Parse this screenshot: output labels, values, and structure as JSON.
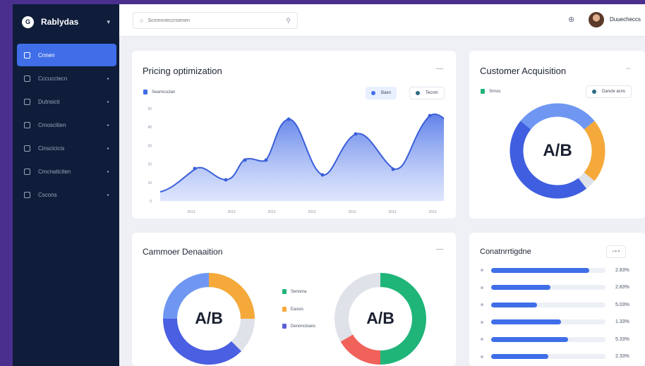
{
  "brand": {
    "name": "Rablydas",
    "logo_letter": "G"
  },
  "nav": [
    {
      "label": "Cnnen",
      "active": true
    },
    {
      "label": "Cccucctecn",
      "active": false
    },
    {
      "label": "Dutnsicti",
      "active": false
    },
    {
      "label": "Cmoscitien",
      "active": false
    },
    {
      "label": "Cinscicicis",
      "active": false
    },
    {
      "label": "Cmcnaticiten",
      "active": false
    },
    {
      "label": "Cscons",
      "active": false
    }
  ],
  "search": {
    "placeholder": "Scnmnneccnsenen"
  },
  "user": {
    "name": "Duuecheccs"
  },
  "pricing": {
    "title": "Pricing optimization",
    "legend": "Searncsctan",
    "chip1": "Baen",
    "chip2": "Tecnm",
    "more": "—",
    "y_ticks": [
      "0",
      "10",
      "20",
      "30",
      "40",
      "50"
    ],
    "x_ticks": [
      "2013",
      "2013",
      "2013",
      "2013",
      "2013",
      "2013",
      "2013"
    ]
  },
  "acquisition": {
    "title": "Customer Acquisition",
    "legend": "Snnsc",
    "chip": "Dancle acns",
    "center": "A/B",
    "more": "--"
  },
  "retention": {
    "title": "Cammoer Denaaition",
    "center1": "A/B",
    "center2": "A/B",
    "legend": [
      "Senoma",
      "Easios",
      "Denoncioans"
    ],
    "more": "—"
  },
  "contrib": {
    "title": "Conatnrrtigdne",
    "chip": "• = =",
    "rows": [
      {
        "value": "2.83%",
        "fraction": 0.86
      },
      {
        "value": "2.83%",
        "fraction": 0.52
      },
      {
        "value": "5.03%",
        "fraction": 0.4
      },
      {
        "value": "1.33%",
        "fraction": 0.61
      },
      {
        "value": "5.33%",
        "fraction": 0.67
      },
      {
        "value": "2.33%",
        "fraction": 0.5
      }
    ]
  },
  "colors": {
    "accent": "#3f6ee8",
    "orange": "#f5a93a",
    "green": "#1fb578",
    "red": "#f0625a",
    "grey": "#dfe2e8",
    "light_blue": "#6f97f2",
    "purple": "#5d5fd6"
  }
}
